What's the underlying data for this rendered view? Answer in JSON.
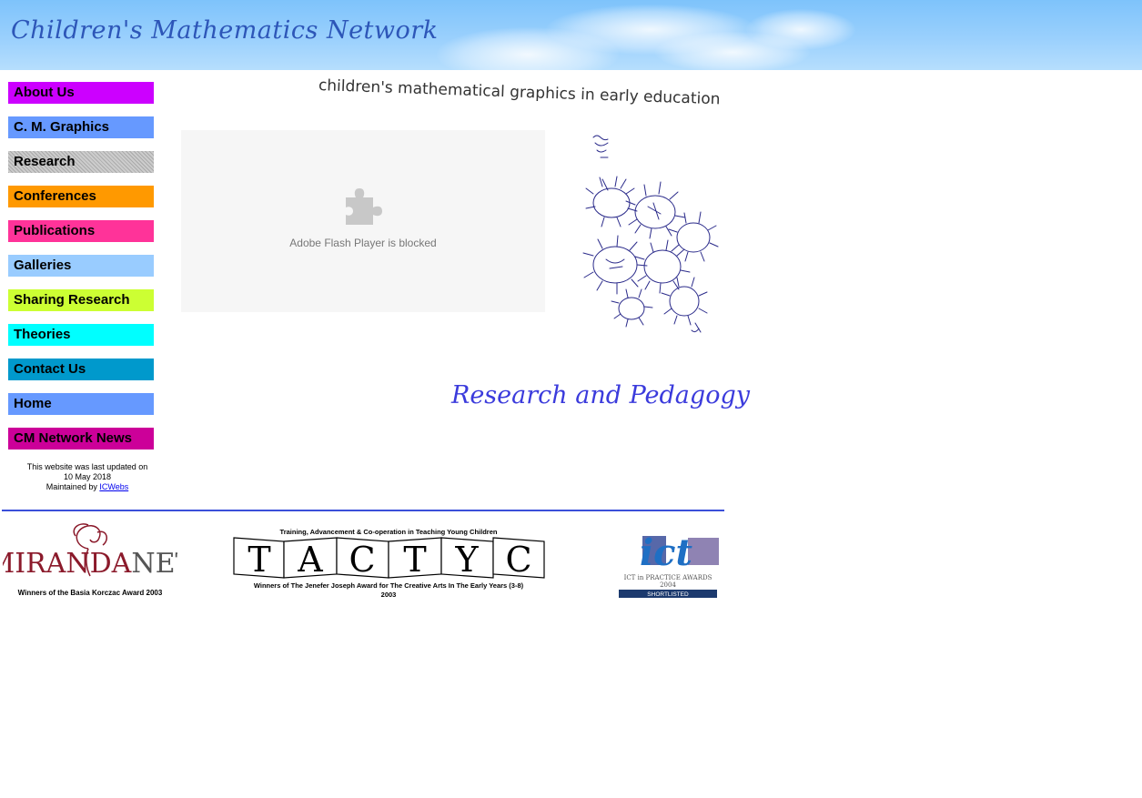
{
  "header": {
    "site_title": "Children's Mathematics Network"
  },
  "nav": {
    "items": [
      {
        "label": "About Us",
        "color": "#cc00ff"
      },
      {
        "label": "C. M. Graphics",
        "color": "#6699ff"
      },
      {
        "label": "Research",
        "color": "#bbbbbb"
      },
      {
        "label": "Conferences",
        "color": "#ff9900"
      },
      {
        "label": "Publications",
        "color": "#ff3399"
      },
      {
        "label": "Galleries",
        "color": "#99ccff"
      },
      {
        "label": "Sharing Research",
        "color": "#ccff33"
      },
      {
        "label": "Theories",
        "color": "#00ffff"
      },
      {
        "label": "Contact Us",
        "color": "#0099cc"
      },
      {
        "label": "Home",
        "color": "#6699ff"
      },
      {
        "label": "CM Network News",
        "color": "#cc0099"
      }
    ]
  },
  "footer_note": {
    "line1": "This website was last updated on",
    "line2": "10 May 2018",
    "maintained_prefix": "Maintained by",
    "maintainer_link": "ICWebs"
  },
  "main": {
    "tagline": "children's mathematical graphics in early education",
    "flash_message": "Adobe Flash Player is blocked",
    "section_heading": "Research and Pedagogy"
  },
  "awards": {
    "miranda_name": "MIRANDA",
    "miranda_name_end": "NET",
    "miranda_caption": "Winners of the Basia Korczac Award 2003",
    "tactyc_top": "Training, Advancement & Co-operation in Teaching Young Children",
    "tactyc_letters": [
      "T",
      "A",
      "C",
      "T",
      "Y",
      "C"
    ],
    "tactyc_caption1": "Winners of The Jenefer Joseph Award for The Creative Arts In The Early Years (3-8)",
    "tactyc_caption2": "2003",
    "ict_logo": "ict",
    "ict_line1": "ICT in PRACTICE AWARDS",
    "ict_year": "2004",
    "ict_badge": "SHORTLISTED"
  }
}
